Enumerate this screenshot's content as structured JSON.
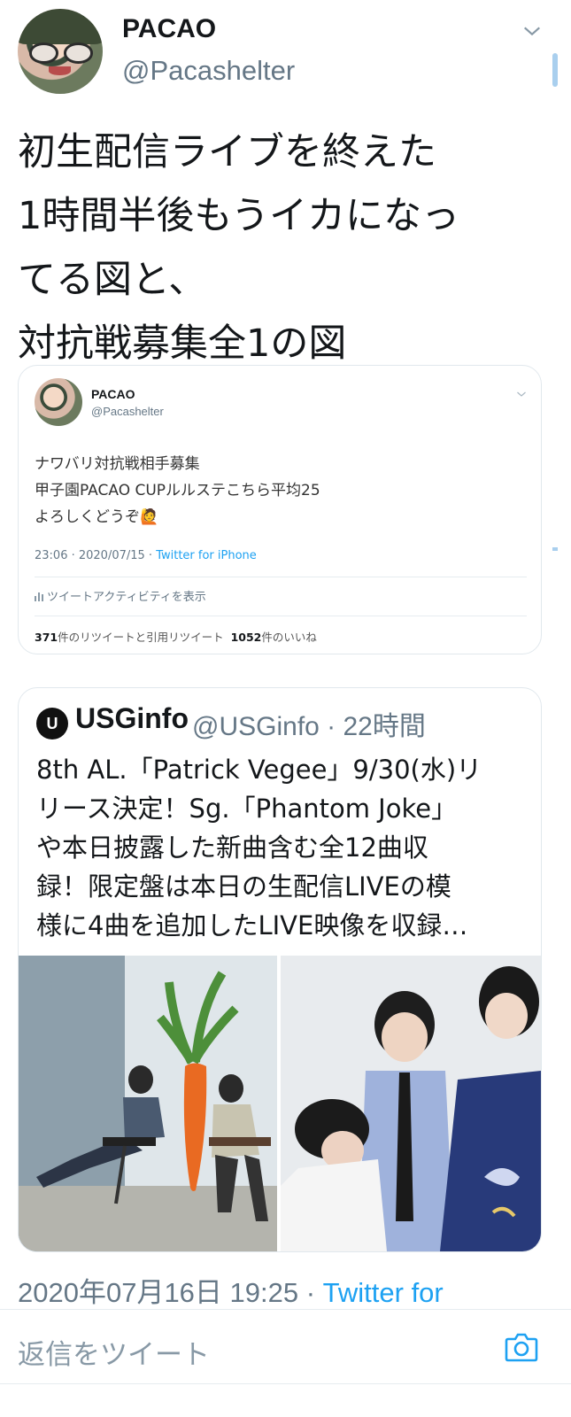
{
  "tweet": {
    "author_name": "PACAO",
    "author_handle": "@Pacashelter",
    "text": "初生配信ライブを終えた\n1時間半後もうイカになっ\nてる図と、\n対抗戦募集全1の図",
    "timestamp": "2020年07月16日 19:25 · ",
    "source": "Twitter for"
  },
  "quoted_tweet": {
    "author_name": "PACAO",
    "author_handle": "@Pacashelter",
    "text": "ナワバリ対抗戦相手募集\n甲子園PACAO CUPルルステこちら平均25\nよろしくどうぞ🙋",
    "time": "23:06 · 2020/07/15 · ",
    "source": "Twitter for iPhone",
    "activity_label": "ツイートアクティビティを表示",
    "retweet_count": "371",
    "retweet_label": "件のリツイートと引用リツイート",
    "like_count": "1052",
    "like_label": "件のいいね"
  },
  "quote_card": {
    "logo_letter": "U",
    "author_name": "USGinfo",
    "meta": "@USGinfo · 22時間",
    "text": "8th AL.「Patrick Vegee」9/30(水)リ\nリース決定！Sg.「Phantom Joke」\nや本日披露した新曲含む全12曲収\n録！限定盤は本日の生配信LIVEの模\n様に4曲を追加したLIVE映像を収録…"
  },
  "reply_bar": {
    "placeholder": "返信をツイート"
  },
  "icons": [
    "chevron-down-icon",
    "activity-icon",
    "camera-icon"
  ],
  "colors": {
    "link": "#1da1f2",
    "muted": "#657786",
    "border": "#e1e8ed"
  }
}
